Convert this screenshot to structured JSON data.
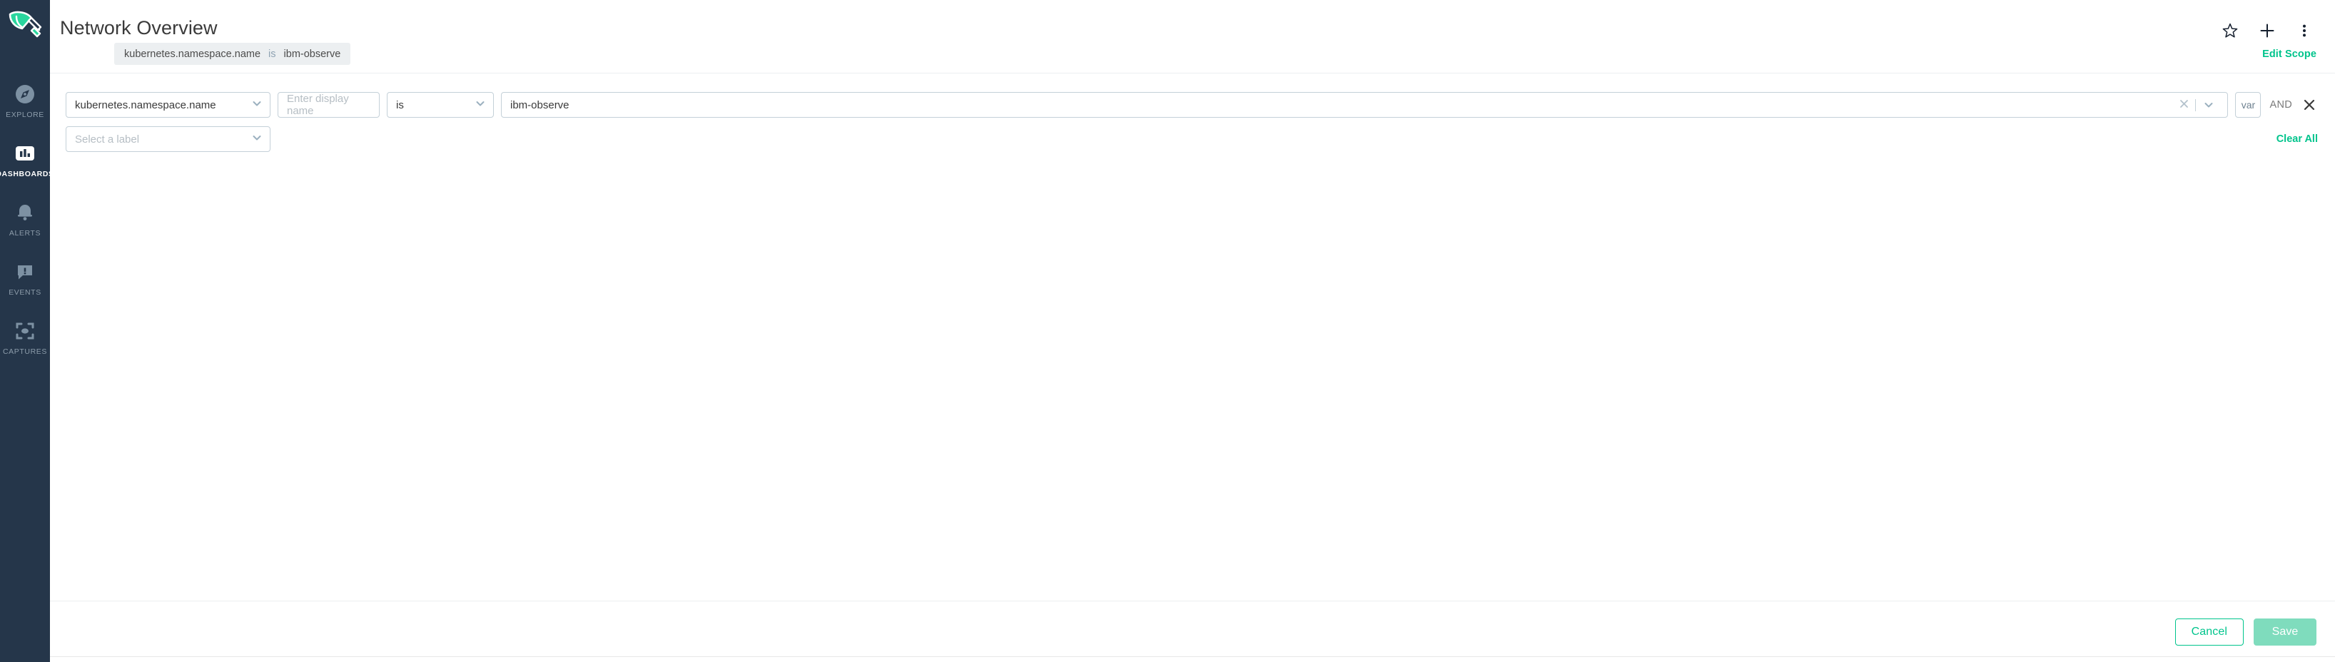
{
  "sidebar": {
    "logo": "sysdig-trowel-logo",
    "items": [
      {
        "label": "EXPLORE",
        "icon": "compass-icon",
        "active": false
      },
      {
        "label": "DASHBOARDS",
        "icon": "bar-chart-icon",
        "active": true
      },
      {
        "label": "ALERTS",
        "icon": "bell-icon",
        "active": false
      },
      {
        "label": "EVENTS",
        "icon": "speech-bubble-alert-icon",
        "active": false
      },
      {
        "label": "CAPTURES",
        "icon": "capture-frame-icon",
        "active": false
      }
    ]
  },
  "header": {
    "title": "Network Overview",
    "actions": [
      {
        "name": "favorite-star-icon",
        "label": "Favorite"
      },
      {
        "name": "plus-icon",
        "label": "Add"
      },
      {
        "name": "kebab-menu-icon",
        "label": "More options"
      }
    ]
  },
  "scope": {
    "chip": {
      "key": "kubernetes.namespace.name",
      "operator": "is",
      "value": "ibm-observe"
    },
    "edit_link": "Edit Scope"
  },
  "filters": {
    "row1": {
      "key_select": "kubernetes.namespace.name",
      "display_name_placeholder": "Enter display name",
      "display_name_value": "",
      "operator_select": "is",
      "value": "ibm-observe",
      "var_button": "var",
      "logic_operator": "AND",
      "clear_value_icon": "clear-x-icon",
      "remove_row_icon": "close-icon"
    },
    "row2": {
      "label_select_placeholder": "Select a label"
    },
    "clear_all": "Clear All"
  },
  "footer": {
    "cancel": "Cancel",
    "save": "Save"
  },
  "colors": {
    "sidebar_bg": "#25364a",
    "accent_green": "#00c48c",
    "save_green": "#7fdcbd",
    "chip_bg": "#eceff1",
    "border": "#c4d0d8"
  }
}
